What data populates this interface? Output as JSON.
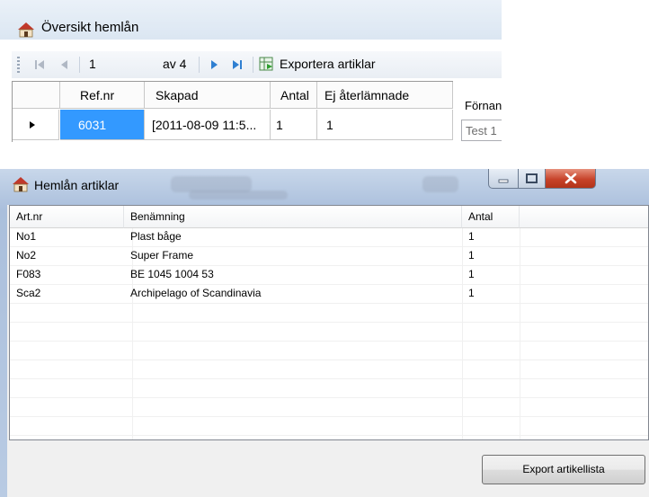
{
  "overview_window": {
    "title": "Översikt hemlån",
    "toolbar": {
      "position": "1",
      "of_count": "av 4",
      "export_label": "Exportera artiklar"
    },
    "grid": {
      "columns": [
        "Ref.nr",
        "Skapad",
        "Antal",
        "Ej återlämnade"
      ],
      "rows": [
        {
          "ref": "6031",
          "created": "[2011-08-09 11:5...",
          "count": "1",
          "not_returned": "1"
        }
      ]
    },
    "side_label": "Förnan",
    "side_input_value": "Test 1"
  },
  "articles_window": {
    "title": "Hemlån artiklar",
    "columns": [
      "Art.nr",
      "Benämning",
      "Antal"
    ],
    "rows": [
      {
        "art": "No1",
        "name": "Plast båge",
        "qty": "1"
      },
      {
        "art": "No2",
        "name": "Super Frame",
        "qty": "1"
      },
      {
        "art": "F083",
        "name": "BE 1045 1004 53",
        "qty": "1"
      },
      {
        "art": "Sca2",
        "name": "Archipelago of Scandinavia",
        "qty": "1"
      }
    ],
    "export_button": "Export artikellista"
  },
  "colors": {
    "selected_cell": "#3399ff",
    "title_bar": "#dbe6f2",
    "close_button": "#c7432a"
  }
}
